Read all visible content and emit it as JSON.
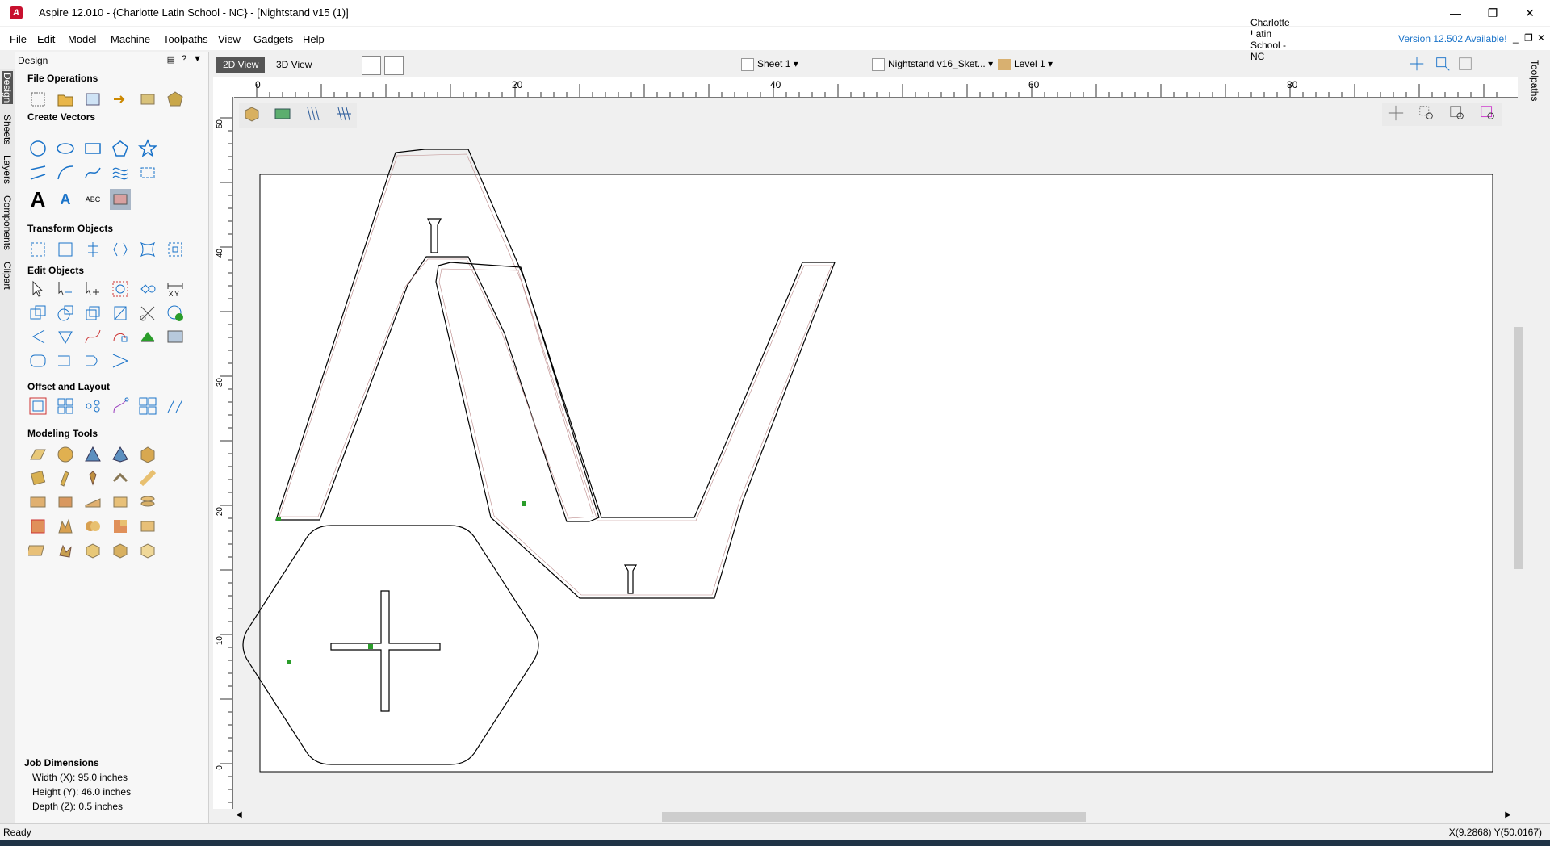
{
  "window": {
    "title": "Aspire 12.010 - {Charlotte Latin School - NC} - [Nightstand v15 (1)]",
    "controls": [
      "minimize-icon",
      "restore-icon",
      "close-icon"
    ]
  },
  "menu": [
    "File",
    "Edit",
    "Model",
    "Machine",
    "Toolpaths",
    "View",
    "Gadgets",
    "Help"
  ],
  "account": {
    "user": "Charlotte Latin School - NC",
    "version_notice": "Version 12.502 Available!"
  },
  "left_tabs": [
    "Design",
    "Sheets",
    "Layers",
    "Components",
    "Clipart"
  ],
  "right_tabs": [
    "Toolpaths"
  ],
  "design_panel": {
    "header": "Design",
    "sections": [
      {
        "title": "File Operations"
      },
      {
        "title": "Create Vectors"
      },
      {
        "title": "Transform Objects"
      },
      {
        "title": "Edit Objects"
      },
      {
        "title": "Offset and Layout"
      },
      {
        "title": "Modeling Tools"
      }
    ],
    "job_dimensions": {
      "title": "Job Dimensions",
      "width": "Width  (X): 95.0 inches",
      "height": "Height (Y): 46.0 inches",
      "depth": "Depth  (Z): 0.5 inches"
    }
  },
  "view_toolbar": {
    "view_2d": "2D View",
    "view_3d": "3D View",
    "sheet": "Sheet 1",
    "sketch": "Nightstand v16_Sket...",
    "level": "Level 1"
  },
  "rulers": {
    "x_ticks": [
      "0",
      "20",
      "40",
      "60",
      "80"
    ],
    "y_ticks": [
      "50",
      "40",
      "30",
      "20",
      "10",
      "0"
    ]
  },
  "status": {
    "left": "Ready",
    "coords": "X(9.2868) Y(50.0167)"
  },
  "colors": {
    "accent": "#1a73c9",
    "app_logo": "#c8102e",
    "active_tab": "#555555",
    "vector_line": "#000000",
    "start_point": "#2a9d2a"
  }
}
